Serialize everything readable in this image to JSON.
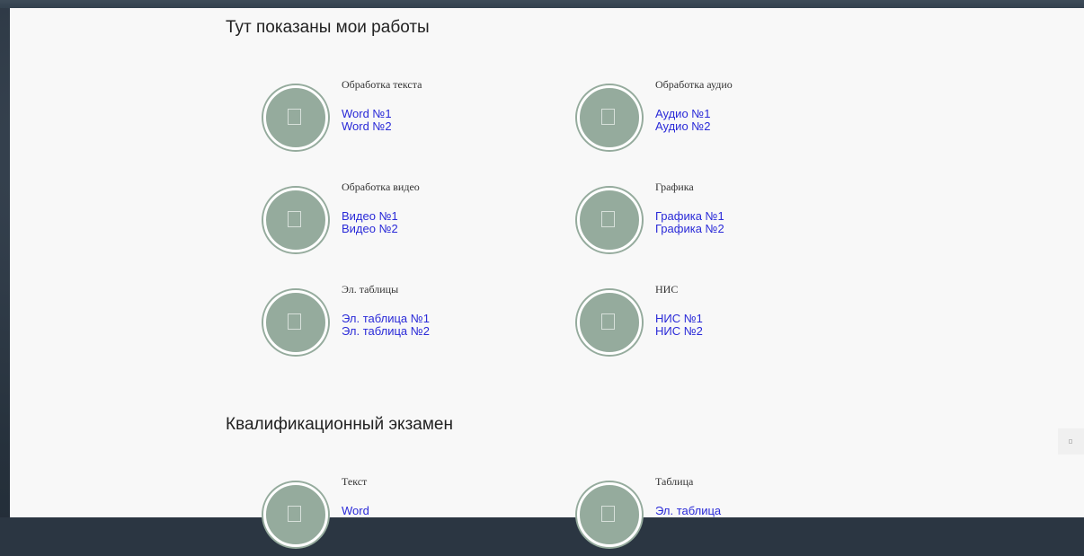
{
  "sections": [
    {
      "title": "Тут показаны мои работы",
      "items": [
        {
          "title": "Обработка текста",
          "icon": "document-icon",
          "links": [
            "Word №1",
            "Word №2"
          ]
        },
        {
          "title": "Обработка аудио",
          "icon": "audio-icon",
          "links": [
            "Аудио №1",
            "Аудио №2"
          ]
        },
        {
          "title": "Обработка видео",
          "icon": "video-icon",
          "links": [
            "Видео №1",
            "Видео №2"
          ]
        },
        {
          "title": "Графика",
          "icon": "image-icon",
          "links": [
            "Графика №1",
            "Графика №2"
          ]
        },
        {
          "title": "Эл. таблицы",
          "icon": "table-icon",
          "links": [
            "Эл. таблица №1",
            "Эл. таблица №2"
          ]
        },
        {
          "title": "НИС",
          "icon": "research-icon",
          "links": [
            "НИС №1",
            "НИС №2"
          ]
        }
      ]
    },
    {
      "title": "Квалификационный экзамен",
      "items": [
        {
          "title": "Текст",
          "icon": "document-icon",
          "links": [
            "Word"
          ]
        },
        {
          "title": "Таблица",
          "icon": "table-icon",
          "links": [
            "Эл. таблица"
          ]
        }
      ]
    }
  ],
  "scroll_top": {
    "icon": "arrow-up-icon"
  },
  "colors": {
    "circle": "#95ab9d",
    "link": "#2a2ad8",
    "panel": "#f8f8f8",
    "background": "#2b3642"
  }
}
